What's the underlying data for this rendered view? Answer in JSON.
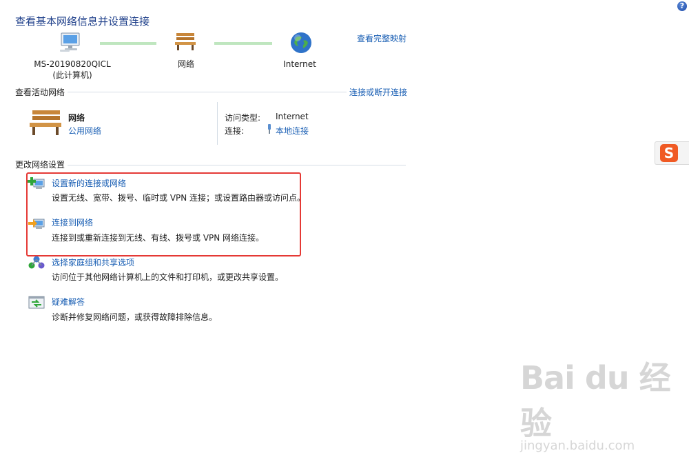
{
  "header": {
    "title": "查看基本网络信息并设置连接",
    "full_map_link": "查看完整映射"
  },
  "network_map": {
    "computer_name": "MS-20190820QICL",
    "computer_sub": "(此计算机)",
    "network_label": "网络",
    "internet_label": "Internet"
  },
  "active_networks": {
    "header": "查看活动网络",
    "connect_link": "连接或断开连接",
    "network_name": "网络",
    "network_type": "公用网络",
    "access_type_label": "访问类型:",
    "access_type_value": "Internet",
    "connection_label": "连接:",
    "connection_value": "本地连接"
  },
  "change_settings": {
    "header": "更改网络设置",
    "items": [
      {
        "title": "设置新的连接或网络",
        "desc": "设置无线、宽带、拨号、临时或 VPN 连接；或设置路由器或访问点。",
        "icon": "new-connection-icon"
      },
      {
        "title": "连接到网络",
        "desc": "连接到或重新连接到无线、有线、拨号或 VPN 网络连接。",
        "icon": "connect-network-icon"
      },
      {
        "title": "选择家庭组和共享选项",
        "desc": "访问位于其他网络计算机上的文件和打印机，或更改共享设置。",
        "icon": "homegroup-icon"
      },
      {
        "title": "疑难解答",
        "desc": "诊断并修复网络问题，或获得故障排除信息。",
        "icon": "troubleshoot-icon"
      }
    ]
  },
  "help_glyph": "?",
  "ime": {
    "glyph": "S"
  },
  "watermark": {
    "logo": "Bai du 经验",
    "sub": "jingyan.baidu.com"
  },
  "colors": {
    "link": "#1a5fb4",
    "title": "#1e3f8a",
    "highlight_box": "#e53935",
    "line": "#bfe6bf"
  }
}
